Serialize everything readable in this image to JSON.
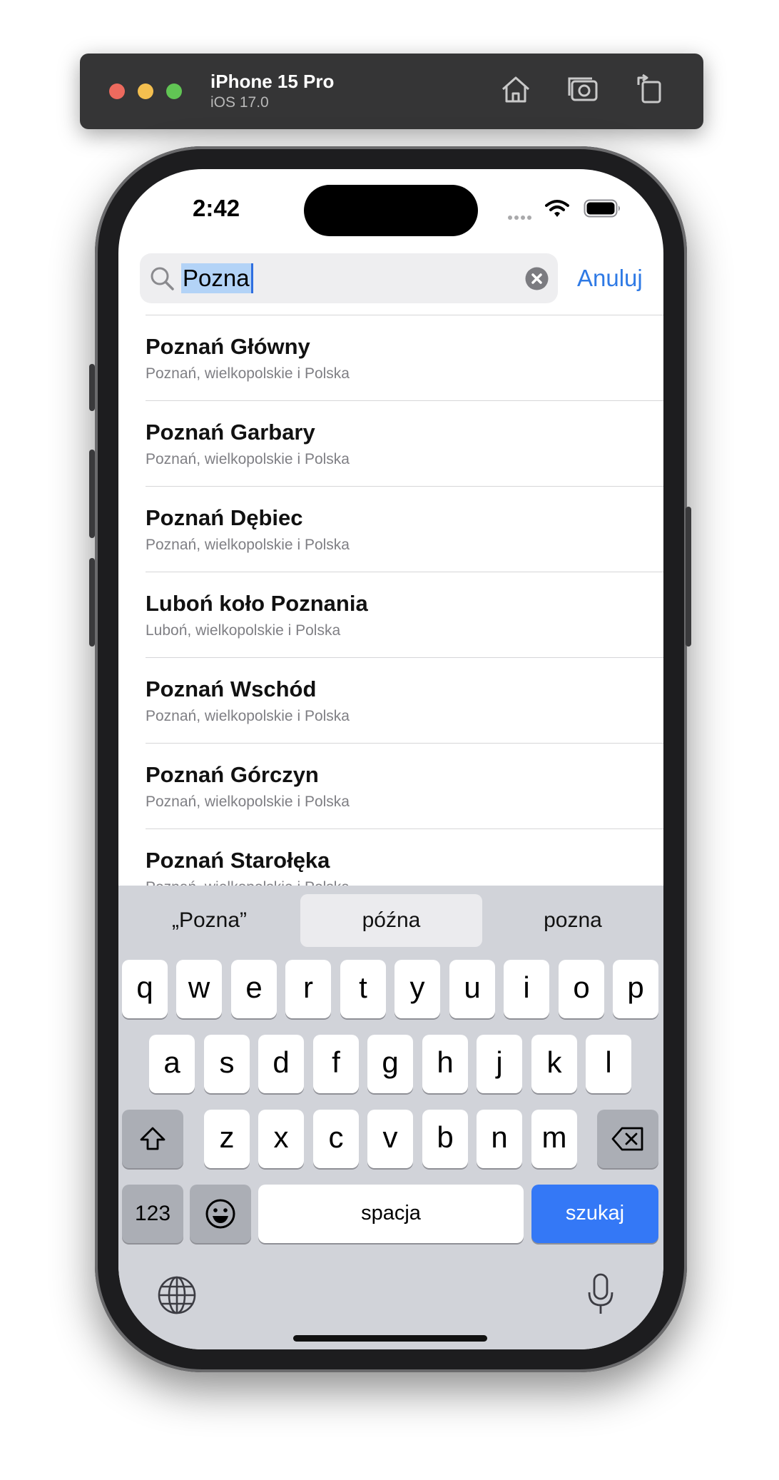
{
  "toolbar": {
    "device_name": "iPhone 15 Pro",
    "os_version": "iOS 17.0",
    "icons": [
      "home-icon",
      "screenshot-icon",
      "rotate-icon"
    ]
  },
  "status_bar": {
    "time": "2:42",
    "icons": [
      "signal-icon",
      "wifi-icon",
      "battery-icon"
    ]
  },
  "search": {
    "query": "Pozna",
    "cancel_label": "Anuluj"
  },
  "results": [
    {
      "title": "Poznań Główny",
      "subtitle": "Poznań, wielkopolskie i Polska"
    },
    {
      "title": "Poznań Garbary",
      "subtitle": "Poznań, wielkopolskie i Polska"
    },
    {
      "title": "Poznań Dębiec",
      "subtitle": "Poznań, wielkopolskie i Polska"
    },
    {
      "title": "Luboń koło Poznania",
      "subtitle": "Luboń, wielkopolskie i Polska"
    },
    {
      "title": "Poznań Wschód",
      "subtitle": "Poznań, wielkopolskie i Polska"
    },
    {
      "title": "Poznań Górczyn",
      "subtitle": "Poznań, wielkopolskie i Polska"
    },
    {
      "title": "Poznań Starołęka",
      "subtitle": "Poznań, wielkopolskie i Polska"
    }
  ],
  "keyboard": {
    "suggestions": [
      "„Pozna”",
      "późna",
      "pozna"
    ],
    "row1": [
      "q",
      "w",
      "e",
      "r",
      "t",
      "y",
      "u",
      "i",
      "o",
      "p"
    ],
    "row2": [
      "a",
      "s",
      "d",
      "f",
      "g",
      "h",
      "j",
      "k",
      "l"
    ],
    "row3": [
      "z",
      "x",
      "c",
      "v",
      "b",
      "n",
      "m"
    ],
    "numbers_label": "123",
    "space_label": "spacja",
    "search_label": "szukaj"
  },
  "colors": {
    "accent": "#2f7ae5",
    "search_key": "#3478f6",
    "keyboard_bg": "#d1d3d9"
  }
}
